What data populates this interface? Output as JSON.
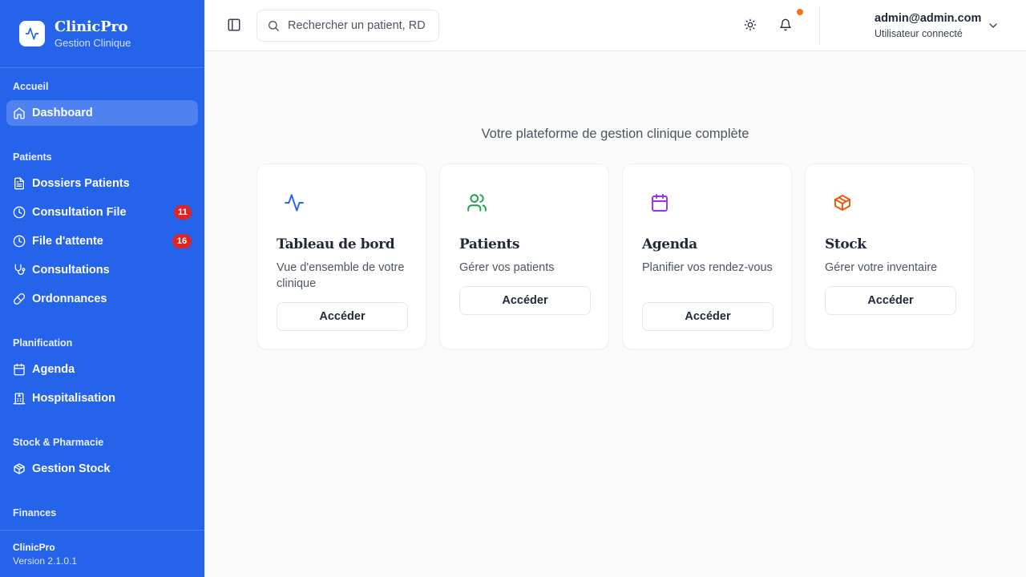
{
  "brand": {
    "title": "ClinicPro",
    "subtitle": "Gestion Clinique"
  },
  "sidebar": {
    "sections": [
      {
        "label": "Accueil"
      },
      {
        "label": "Patients"
      },
      {
        "label": "Planification"
      },
      {
        "label": "Stock & Pharmacie"
      },
      {
        "label": "Finances"
      }
    ],
    "items": [
      {
        "label": "Dashboard",
        "icon": "home-icon",
        "active": true
      },
      {
        "label": "Dossiers Patients",
        "icon": "file-text-icon"
      },
      {
        "label": "Consultation File",
        "icon": "clock-icon",
        "badge": "11"
      },
      {
        "label": "File d'attente",
        "icon": "clock-icon",
        "badge": "16"
      },
      {
        "label": "Consultations",
        "icon": "stethoscope-icon"
      },
      {
        "label": "Ordonnances",
        "icon": "pill-icon"
      },
      {
        "label": "Agenda",
        "icon": "calendar-icon"
      },
      {
        "label": "Hospitalisation",
        "icon": "hospital-icon"
      },
      {
        "label": "Gestion Stock",
        "icon": "package-icon"
      }
    ],
    "footer": {
      "name": "ClinicPro",
      "version": "Version 2.1.0.1"
    }
  },
  "header": {
    "search_placeholder": "Rechercher un patient, RDV...",
    "user_email": "admin@admin.com",
    "user_status": "Utilisateur connecté",
    "notification_dot_color": "#f97316"
  },
  "main": {
    "tagline": "Votre plateforme de gestion clinique complète",
    "cards": [
      {
        "title": "Tableau de bord",
        "description": "Vue d'ensemble de votre clinique",
        "button": "Accéder",
        "icon": "activity-icon",
        "color": "#2563eb"
      },
      {
        "title": "Patients",
        "description": "Gérer vos patients",
        "button": "Accéder",
        "icon": "users-icon",
        "color": "#16a34a"
      },
      {
        "title": "Agenda",
        "description": "Planifier vos rendez-vous",
        "button": "Accéder",
        "icon": "calendar-icon",
        "color": "#9333ea"
      },
      {
        "title": "Stock",
        "description": "Gérer votre inventaire",
        "button": "Accéder",
        "icon": "package-icon",
        "color": "#ea580c"
      }
    ]
  },
  "colors": {
    "sidebar": "#2563eb",
    "badge": "#dc2626"
  }
}
